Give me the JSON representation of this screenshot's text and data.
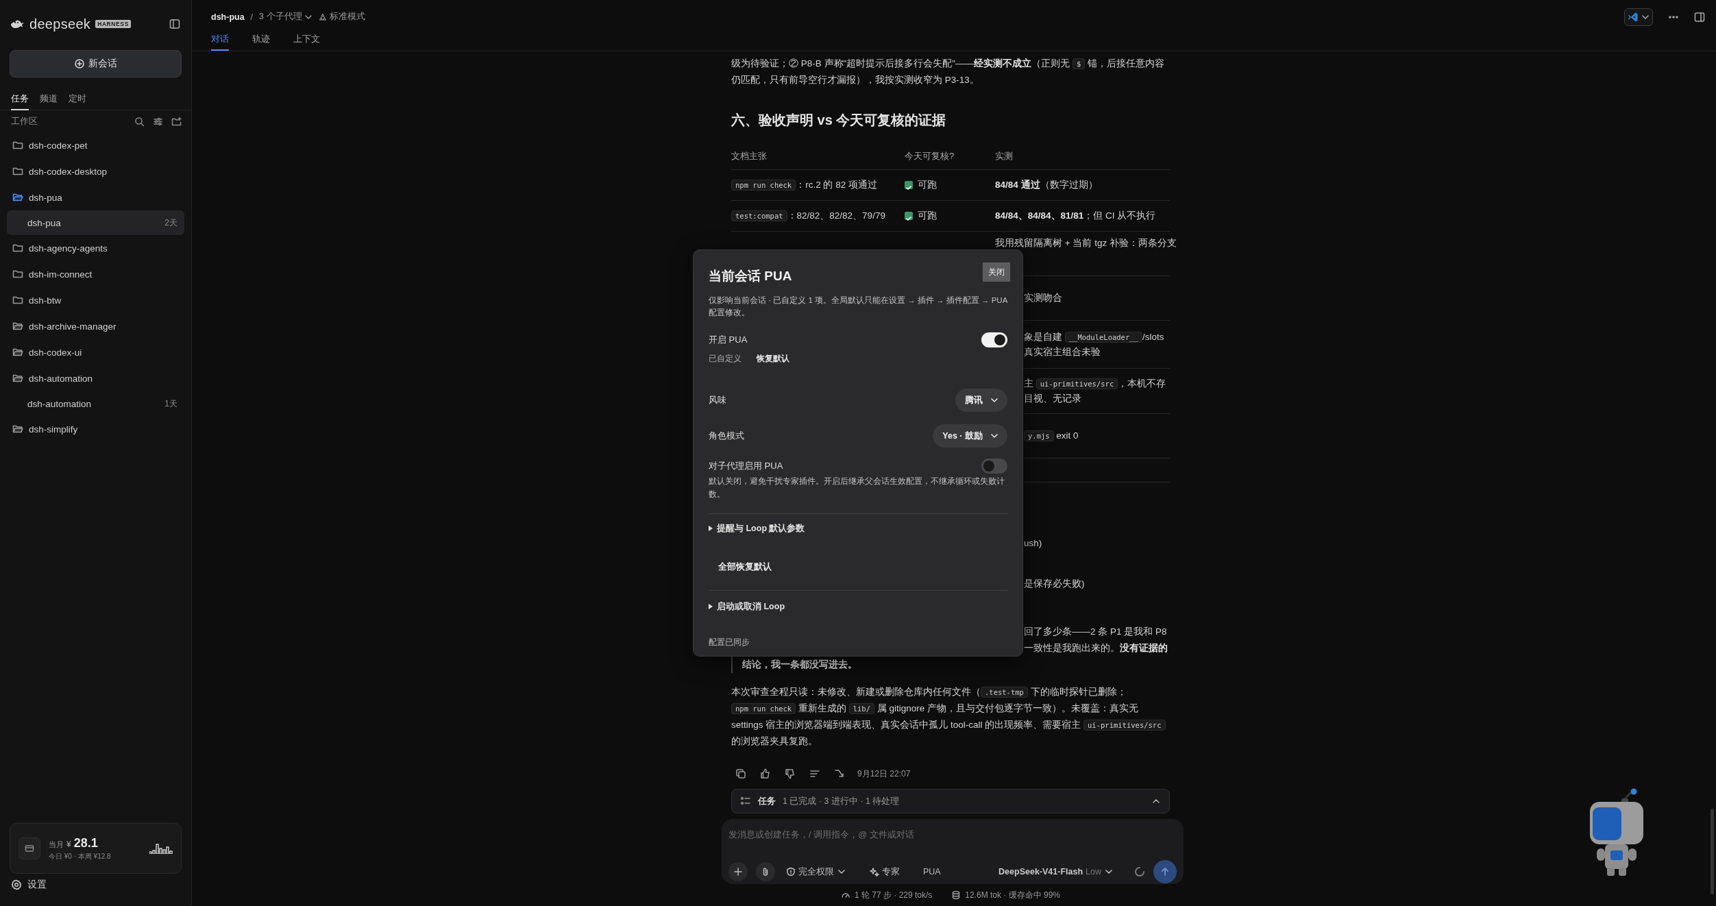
{
  "sidebar": {
    "brand": {
      "name": "deepseek",
      "badge": "HARNESS"
    },
    "new_chat_button": "新会话",
    "tabs": [
      {
        "label": "任务",
        "selected": true
      },
      {
        "label": "频道",
        "selected": false
      },
      {
        "label": "定时",
        "selected": false
      }
    ],
    "section_label": "工作区",
    "workspaces": [
      {
        "name": "dsh-codex-pet",
        "open": false,
        "selected": false
      },
      {
        "name": "dsh-codex-desktop",
        "open": false,
        "selected": false
      },
      {
        "name": "dsh-pua",
        "open": true,
        "selected": true,
        "children": [
          {
            "name": "dsh-pua",
            "age": "2天",
            "selected": true
          }
        ]
      },
      {
        "name": "dsh-agency-agents",
        "open": false,
        "selected": false
      },
      {
        "name": "dsh-im-connect",
        "open": false,
        "selected": false
      },
      {
        "name": "dsh-btw",
        "open": false,
        "selected": false
      },
      {
        "name": "dsh-archive-manager",
        "open": true,
        "selected": false
      },
      {
        "name": "dsh-codex-ui",
        "open": true,
        "selected": false
      },
      {
        "name": "dsh-automation",
        "open": true,
        "selected": false,
        "children": [
          {
            "name": "dsh-automation",
            "age": "1天",
            "selected": false
          }
        ]
      },
      {
        "name": "dsh-simplify",
        "open": true,
        "selected": false
      }
    ],
    "usage": {
      "label": "当月",
      "currency": "¥",
      "amount": "28.1",
      "detail": "今日 ¥0 · 本周 ¥12.8"
    },
    "settings": "设置"
  },
  "header": {
    "project": "dsh-pua",
    "separator": "/",
    "agents": "3 个子代理",
    "mode": "标准模式",
    "tabs": [
      {
        "label": "对话",
        "selected": true
      },
      {
        "label": "轨迹",
        "selected": false
      },
      {
        "label": "上下文",
        "selected": false
      }
    ]
  },
  "conversation": {
    "intro": [
      {
        "kind": "text",
        "text": "级为待验证；② P8-B 声称\"超时提示后接多行会失配\"——"
      },
      {
        "kind": "bold",
        "text": "经实测不成立"
      },
      {
        "kind": "text",
        "text": "（正则无 "
      },
      {
        "kind": "code",
        "text": "$"
      },
      {
        "kind": "text",
        "text": " 锚，后接任意内容仍匹配，只有前导空行才漏报），我按实测收窄为 P3-13。"
      }
    ],
    "heading": "六、验收声明 vs 今天可复核的证据",
    "table": {
      "columns": [
        "文档主张",
        "今天可复核?",
        "实测"
      ],
      "rows": [
        {
          "claim": [
            {
              "kind": "code",
              "text": "npm run check"
            },
            {
              "kind": "text",
              "text": "：rc.2 的 82 项通过"
            }
          ],
          "status": {
            "text": "可跑",
            "checked": true
          },
          "result": [
            [
              {
                "kind": "bold",
                "text": "84/84 通过"
              },
              {
                "kind": "text",
                "text": "（数字过期）"
              }
            ]
          ]
        },
        {
          "claim": [
            {
              "kind": "code",
              "text": "test:compat"
            },
            {
              "kind": "text",
              "text": "：82/82、82/82、79/79"
            }
          ],
          "status": {
            "text": "可跑",
            "checked": true
          },
          "result": [
            [
              {
                "kind": "bold",
                "text": "84/84、84/84、81/81"
              },
              {
                "kind": "text",
                "text": "；但 CI 从不执行"
              }
            ]
          ]
        },
        {
          "result": [
            [
              {
                "kind": "text",
                "text": "我用残留隔离树 + 当前 tgz 补验：两条分支"
              }
            ]
          ]
        },
        {
          "result": [
            [
              {
                "kind": "text",
                "text": "实测吻合"
              }
            ]
          ]
        },
        {
          "result": [
            [
              {
                "kind": "text",
                "text": "象是自建 "
              },
              {
                "kind": "code",
                "text": "__ModuleLoader__"
              },
              {
                "kind": "text",
                "text": "/slots"
              }
            ],
            [
              {
                "kind": "text",
                "text": "真实宿主组合未验"
              }
            ]
          ]
        },
        {
          "result": [
            [
              {
                "kind": "text",
                "text": "主 "
              },
              {
                "kind": "code",
                "text": "ui-primitives/src"
              },
              {
                "kind": "text",
                "text": "，本机不存"
              }
            ],
            [
              {
                "kind": "text",
                "text": "目视、无记录"
              }
            ]
          ]
        },
        {
          "result": [
            [
              {
                "kind": "code",
                "text": "y.mjs"
              },
              {
                "kind": "text",
                "text": " exit 0"
              }
            ]
          ]
        },
        {
          "result": []
        }
      ]
    },
    "fragments": [
      [
        {
          "kind": "text",
          "text": "ush)"
        }
      ],
      [
        {
          "kind": "text",
          "text": "是保存必失败)"
        }
      ]
    ],
    "quote": [
      [
        {
          "kind": "text",
          "text": "回了多少条——2 条 P1 是我和 P8"
        }
      ],
      [
        {
          "kind": "text",
          "text": "一致性是我跑出来的。"
        },
        {
          "kind": "bold",
          "text": "没有证据的"
        }
      ],
      [
        {
          "kind": "bold",
          "text": "结论，我一条都没写进去。"
        }
      ]
    ],
    "paragraph": [
      {
        "kind": "text",
        "text": "本次审查全程只读：未修改、新建或删除仓库内任何文件（"
      },
      {
        "kind": "code",
        "text": ".test-tmp"
      },
      {
        "kind": "text",
        "text": " 下的临时探针已删除；"
      },
      {
        "kind": "code",
        "text": "npm run check"
      },
      {
        "kind": "text",
        "text": " 重新生成的 "
      },
      {
        "kind": "code",
        "text": "lib/"
      },
      {
        "kind": "text",
        "text": " 属 gitignore 产物，且与交付包逐字节一致）。未覆盖：真实无 settings 宿主的浏览器端到端表现、真实会话中孤儿 tool-call 的出现频率、需要宿主 "
      },
      {
        "kind": "code",
        "text": "ui-primitives/src"
      },
      {
        "kind": "text",
        "text": " 的浏览器夹具复跑。"
      }
    ],
    "timestamp": "9月12日 22:07"
  },
  "tasks": {
    "label": "任务",
    "summary": "1 已完成 · 3 进行中 · 1 待处理",
    "expanded": true
  },
  "composer": {
    "placeholder": "发消息或创建任务，/ 调用指令，@ 文件或对话",
    "permission": "完全权限",
    "expert": "专家",
    "plugin": "PUA",
    "model": "DeepSeek-V41-Flash",
    "effort": "Low"
  },
  "status_bar": {
    "speed": "1 轮 77 步 · 229 tok/s",
    "tokens": "12.6M tok · 缓存命中 99%"
  },
  "modal": {
    "title": "当前会话 PUA",
    "close": "关闭",
    "description": "仅影响当前会话 · 已自定义 1 项。全局默认只能在设置 → 插件 → 插件配置 → PUA 配置修改。",
    "enable": {
      "label": "开启 PUA",
      "on": true
    },
    "custom_state": "已自定义",
    "reset": "恢复默认",
    "selects": [
      {
        "label": "风味",
        "value": "腾讯"
      },
      {
        "label": "角色模式",
        "value": "Yes · 鼓励"
      }
    ],
    "subagent": {
      "label": "对子代理启用 PUA",
      "on": false,
      "description": "默认关闭，避免干扰专家插件。开启后继承父会话生效配置，不继承循环或失败计数。"
    },
    "disclosures": [
      {
        "label": "提醒与 Loop 默认参数",
        "expanded": false
      },
      {
        "label": "启动或取消 Loop",
        "expanded": false
      }
    ],
    "reset_all": "全部恢复默认",
    "footer": "配置已同步"
  }
}
